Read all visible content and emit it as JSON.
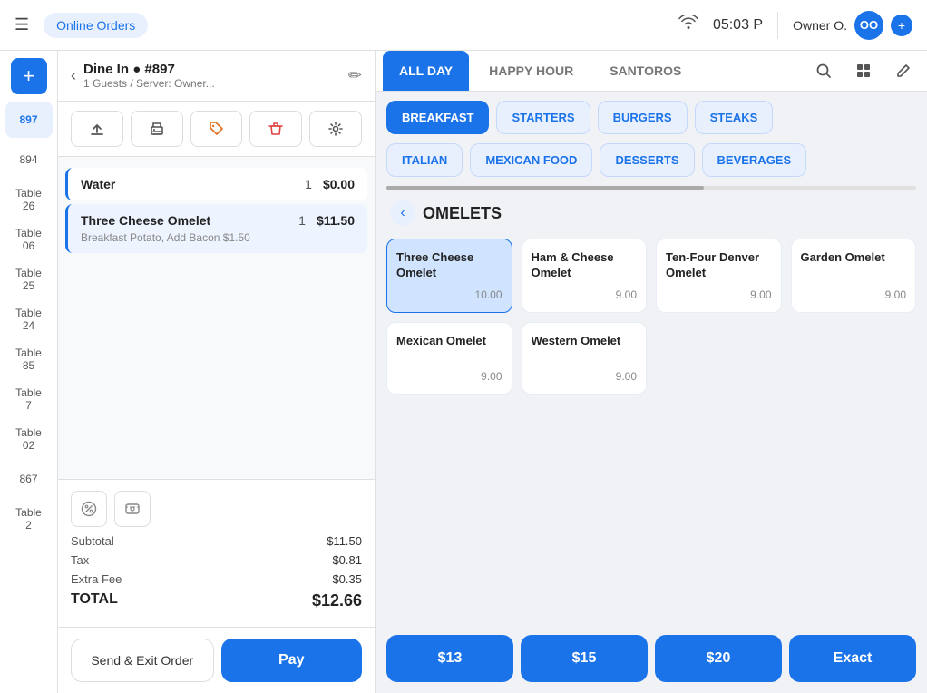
{
  "header": {
    "menu_icon": "☰",
    "online_orders_label": "Online Orders",
    "wifi_icon": "wifi",
    "time": "05:03 P",
    "owner_label": "Owner O.",
    "owner_initials": "OO",
    "expand_icon": "+"
  },
  "sidebar": {
    "add_icon": "+",
    "items": [
      {
        "id": "897",
        "label": "897",
        "active": true
      },
      {
        "id": "894",
        "label": "894",
        "active": false
      },
      {
        "id": "table-26",
        "label": "Table\n26",
        "active": false
      },
      {
        "id": "table-06",
        "label": "Table\n06",
        "active": false
      },
      {
        "id": "table-25",
        "label": "Table\n25",
        "active": false
      },
      {
        "id": "table-24",
        "label": "Table\n24",
        "active": false
      },
      {
        "id": "table-85",
        "label": "Table\n85",
        "active": false
      },
      {
        "id": "table-7",
        "label": "Table\n7",
        "active": false
      },
      {
        "id": "table-02",
        "label": "Table\n02",
        "active": false
      },
      {
        "id": "867",
        "label": "867",
        "active": false
      },
      {
        "id": "table-2",
        "label": "Table\n2",
        "active": false
      }
    ]
  },
  "order": {
    "back_icon": "‹",
    "dine_in": "Dine In",
    "order_num": "#897",
    "guests_server": "1 Guests / Server: Owner...",
    "edit_icon": "✏",
    "action_icons": [
      "↑",
      "🖨",
      "🏷",
      "🗑",
      "⚙"
    ],
    "items": [
      {
        "name": "Water",
        "qty": "1",
        "price": "$0.00",
        "mods": ""
      },
      {
        "name": "Three Cheese Omelet",
        "qty": "1",
        "price": "$11.50",
        "mods": "Breakfast Potato, Add Bacon $1.50"
      }
    ],
    "subtotal_label": "Subtotal",
    "subtotal_value": "$11.50",
    "tax_label": "Tax",
    "tax_value": "$0.81",
    "extra_fee_label": "Extra Fee",
    "extra_fee_value": "$0.35",
    "total_label": "TOTAL",
    "total_value": "$12.66",
    "send_exit_label": "Send & Exit Order",
    "pay_label": "Pay"
  },
  "menu": {
    "tabs": [
      {
        "label": "ALL DAY",
        "active": true
      },
      {
        "label": "HAPPY HOUR",
        "active": false
      },
      {
        "label": "SANTOROS",
        "active": false
      }
    ],
    "tab_icons": [
      "search",
      "grid",
      "edit"
    ],
    "categories": [
      {
        "label": "BREAKFAST",
        "active": true
      },
      {
        "label": "STARTERS",
        "active": false
      },
      {
        "label": "BURGERS",
        "active": false
      },
      {
        "label": "STEAKS",
        "active": false
      },
      {
        "label": "ITALIAN",
        "active": false
      },
      {
        "label": "MEXICAN FOOD",
        "active": false
      },
      {
        "label": "DESSERTS",
        "active": false
      },
      {
        "label": "BEVERAGES",
        "active": false
      }
    ],
    "section_back": "‹",
    "section_title": "OMELETS",
    "items": [
      {
        "name": "Three Cheese Omelet",
        "price": "10.00",
        "active": true
      },
      {
        "name": "Ham & Cheese Omelet",
        "price": "9.00",
        "active": false
      },
      {
        "name": "Ten-Four Denver Omelet",
        "price": "9.00",
        "active": false
      },
      {
        "name": "Garden Omelet",
        "price": "9.00",
        "active": false
      },
      {
        "name": "Mexican Omelet",
        "price": "9.00",
        "active": false
      },
      {
        "name": "Western Omelet",
        "price": "9.00",
        "active": false
      }
    ],
    "quick_pay": [
      {
        "label": "$13"
      },
      {
        "label": "$15"
      },
      {
        "label": "$20"
      },
      {
        "label": "Exact"
      }
    ]
  }
}
